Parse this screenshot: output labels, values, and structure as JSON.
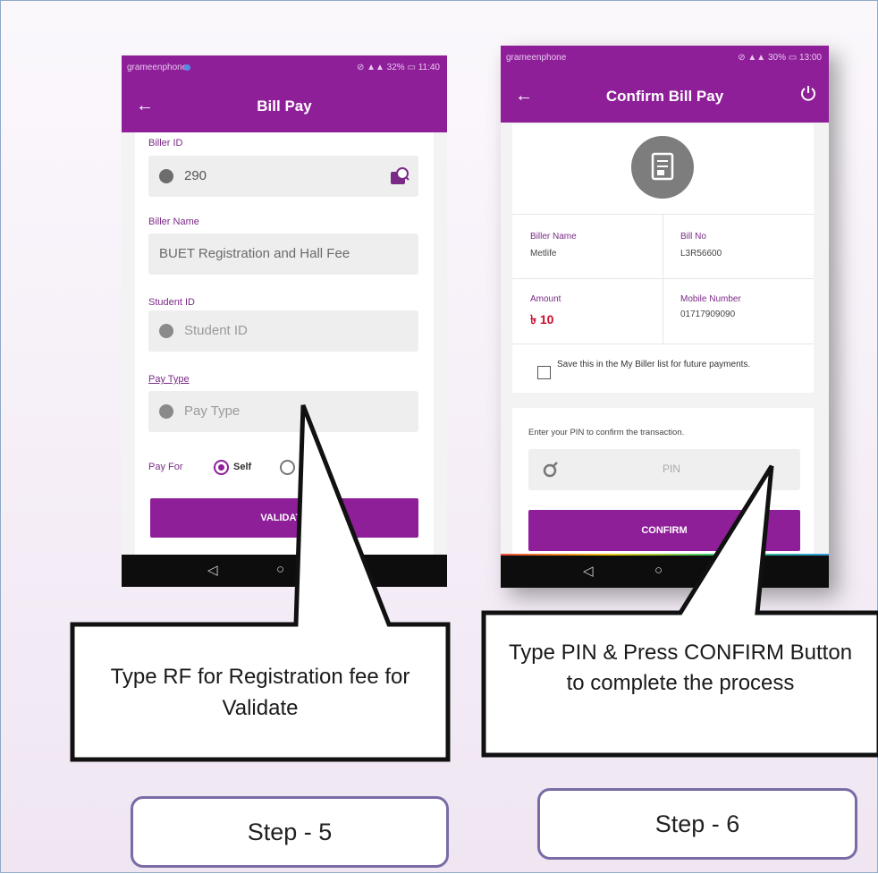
{
  "phone1": {
    "status_left": "grameenphone",
    "status_right": "⊘ ▲▲ 32% ▭ 11:40",
    "title": "Bill Pay",
    "biller_id_label": "Biller ID",
    "biller_id_value": "290",
    "biller_name_label": "Biller Name",
    "biller_name_value": "BUET Registration and Hall Fee",
    "student_id_label": "Student ID",
    "student_id_placeholder": "Student ID",
    "pay_type_label": "Pay Type",
    "pay_type_placeholder": "Pay Type",
    "pay_for_label": "Pay For",
    "pay_for_self": "Self",
    "validate_button": "VALIDATE"
  },
  "phone2": {
    "status_left": "grameenphone",
    "status_right": "⊘ ▲▲ 30% ▭ 13:00",
    "title": "Confirm Bill Pay",
    "biller_name_label": "Biller Name",
    "biller_name_value": "Metlife",
    "bill_no_label": "Bill No",
    "bill_no_value": "L3R56600",
    "amount_label": "Amount",
    "amount_value": "৳ 10",
    "mobile_label": "Mobile Number",
    "mobile_value": "01717909090",
    "save_text": "Save this in the My Biller list for future payments.",
    "pin_prompt": "Enter your PIN to confirm the transaction.",
    "pin_placeholder": "PIN",
    "confirm_button": "CONFIRM"
  },
  "nav": {
    "back": "◁",
    "home": "○"
  },
  "callouts": {
    "step5_text": "Type RF for Registration fee for Validate",
    "step6_text": "Type PIN & Press CONFIRM Button to complete the process"
  },
  "steps": {
    "step5": "Step - 5",
    "step6": "Step - 6"
  },
  "colors": {
    "brand": "#8e1f99",
    "amount": "#c8102e"
  }
}
